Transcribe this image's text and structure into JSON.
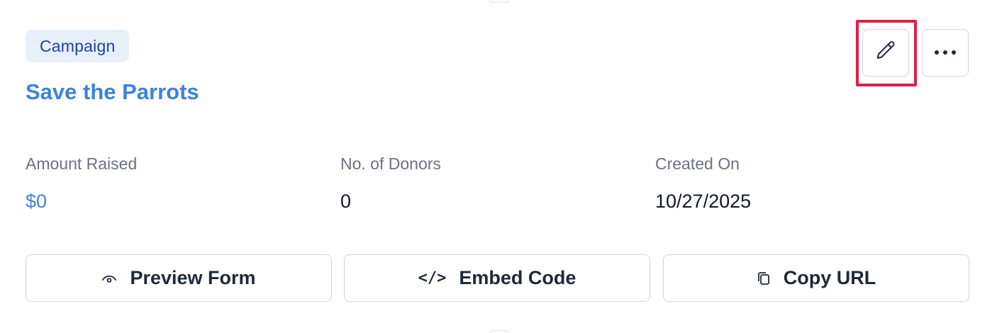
{
  "card": {
    "badge": "Campaign",
    "title": "Save the Parrots"
  },
  "header_actions": {
    "edit_icon": "pencil-icon",
    "more_icon": "ellipsis-icon",
    "highlight_color": "#e11d48"
  },
  "stats": [
    {
      "label": "Amount Raised",
      "value": "$0"
    },
    {
      "label": "No. of Donors",
      "value": "0"
    },
    {
      "label": "Created On",
      "value": "10/27/2025"
    }
  ],
  "actions": [
    {
      "label": "Preview Form",
      "icon": "eye-icon"
    },
    {
      "label": "Embed Code",
      "icon": "code-icon",
      "glyph": "</>"
    },
    {
      "label": "Copy URL",
      "icon": "copy-icon"
    }
  ],
  "colors": {
    "accent": "#3b82e0",
    "badge_bg": "#e6effa",
    "badge_text": "#1e40af",
    "muted": "#6b7280",
    "border": "#d1d5db"
  }
}
